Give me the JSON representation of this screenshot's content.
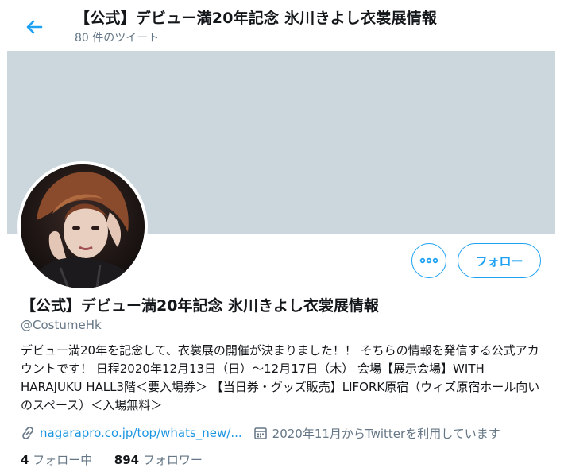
{
  "header": {
    "title": "【公式】デビュー満20年記念 氷川きよし衣裳展情報",
    "tweet_count": "80 件のツイート"
  },
  "profile": {
    "display_name": "【公式】デビュー満20年記念 氷川きよし衣裳展情報",
    "handle": "@CostumeHk",
    "bio": "デビュー満20年を記念して、衣裳展の開催が決まりました！！ そちらの情報を発信する公式アカウントです！ 日程2020年12月13日（日）～12月17日（木） 会場【展示会場】WITH HARAJUKU HALL3階＜要入場券＞ 【当日券・グッズ販売】LIFORK原宿（ウィズ原宿ホール向いのスペース）＜入場無料＞",
    "website": "nagarapro.co.jp/top/whats_new/...",
    "joined": "2020年11月からTwitterを利用しています",
    "following_count": "4",
    "following_label": "フォロー中",
    "followers_count": "894",
    "followers_label": "フォロワー"
  },
  "actions": {
    "follow_label": "フォロー"
  },
  "icons": {
    "back": "arrow-left-icon",
    "more": "more-horizontal-icon",
    "link": "link-icon",
    "calendar": "calendar-icon"
  },
  "colors": {
    "accent": "#1da1f2",
    "banner": "#ccd6dd",
    "secondary_text": "#657786"
  }
}
